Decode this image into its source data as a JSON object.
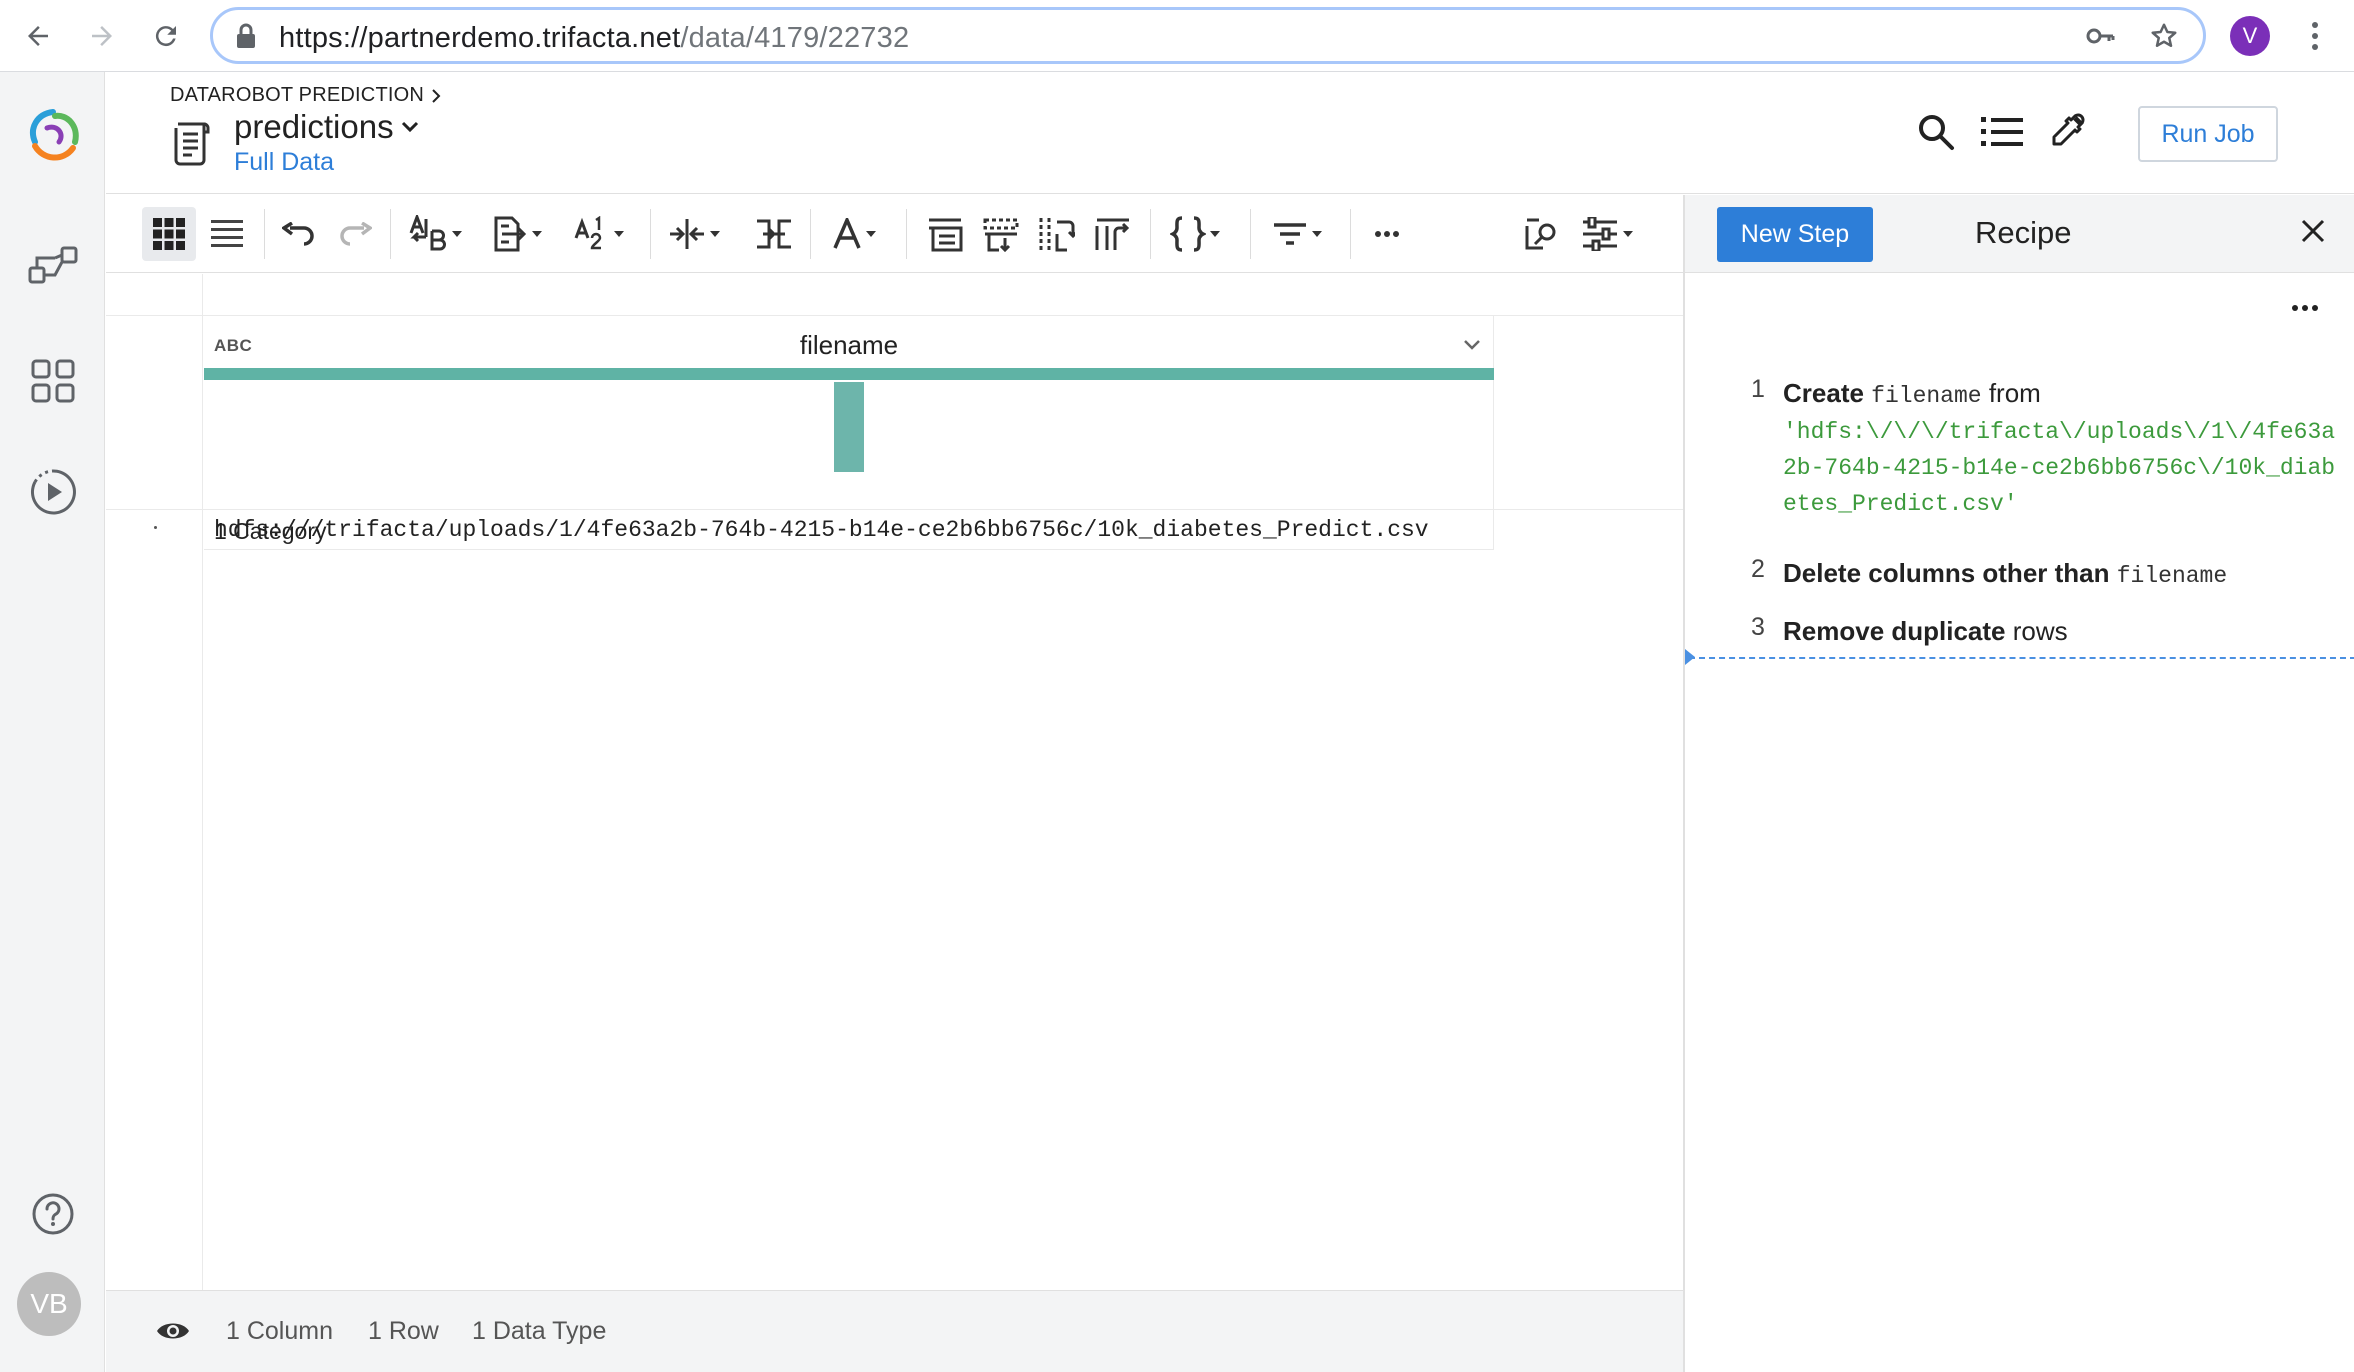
{
  "browser": {
    "url_host": "https://partnerdemo.trifacta.net",
    "url_path": "/data/4179/22732",
    "profile_initial": "V"
  },
  "header": {
    "breadcrumb": "DATAROBOT PREDICTION",
    "title": "predictions",
    "subtitle": "Full Data",
    "run_job_label": "Run Job"
  },
  "leftnav": {
    "avatar_initials": "VB"
  },
  "grid": {
    "columns": [
      {
        "type_label": "ABC",
        "name": "filename",
        "category_label": "1 Category",
        "quality_valid_fraction": 1.0
      }
    ],
    "rows": [
      [
        "hdfs:///trifacta/uploads/1/4fe63a2b-764b-4215-b14e-ce2b6bb6756c/10k_diabetes_Predict.csv"
      ]
    ]
  },
  "status": {
    "columns": "1 Column",
    "rows": "1 Row",
    "types": "1 Data Type"
  },
  "recipe": {
    "new_step_label": "New Step",
    "title": "Recipe",
    "steps": [
      {
        "num": "1",
        "verb": "Create",
        "target": "filename",
        "connector": "from",
        "value": "'hdfs:\\/\\/\\/trifacta\\/uploads\\/1\\/4fe63a2b-764b-4215-b14e-ce2b6bb6756c\\/10k_diabetes_Predict.csv'"
      },
      {
        "num": "2",
        "verb": "Delete columns other than",
        "target": "filename"
      },
      {
        "num": "3",
        "verb": "Remove duplicate",
        "rest": "rows"
      }
    ]
  },
  "colors": {
    "accent": "#2d7ed8",
    "quality_valid": "#5fb3a5",
    "recipe_value": "#3c9a3c"
  }
}
